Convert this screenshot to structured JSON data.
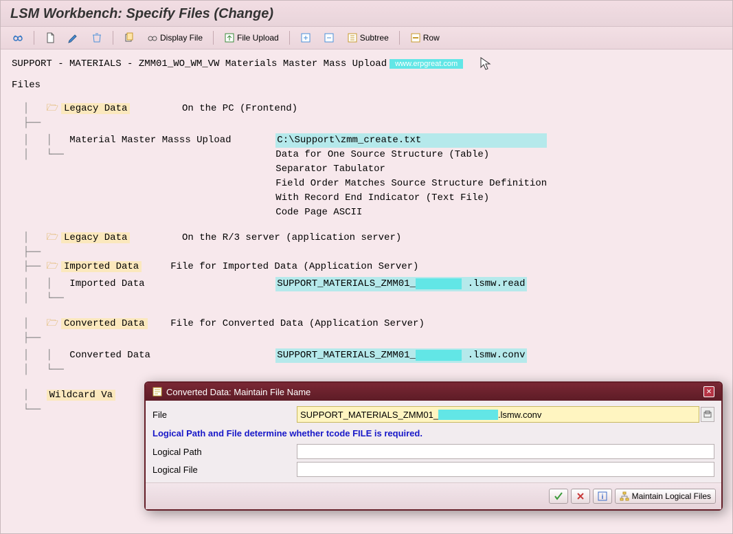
{
  "title": "LSM Workbench: Specify Files (Change)",
  "toolbar": {
    "display_file": "Display File",
    "file_upload": "File Upload",
    "subtree": "Subtree",
    "row": "Row"
  },
  "breadcrumb": "SUPPORT - MATERIALS - ZMM01_WO_WM_VW Materials Master Mass Upload",
  "watermark": "www.erpgreat.com",
  "tree": {
    "root": "Files",
    "legacy_pc": {
      "label": "Legacy Data",
      "desc": "On the PC (Frontend)",
      "child_label": "Material Master Masss Upload",
      "path": "C:\\Support\\zmm_create.txt",
      "lines": [
        "Data for One Source Structure (Table)",
        "Separator Tabulator",
        "Field Order Matches Source Structure Definition",
        "With Record End Indicator (Text File)",
        "Code Page ASCII"
      ]
    },
    "legacy_r3": {
      "label": "Legacy Data",
      "desc": "On the R/3 server (application server)"
    },
    "imported": {
      "label": "Imported Data",
      "desc": "File for Imported Data (Application Server)",
      "child_label": "Imported Data",
      "file_prefix": "SUPPORT_MATERIALS_ZMM01_",
      "file_suffix": ".lsmw.read"
    },
    "converted": {
      "label": "Converted Data",
      "desc": "File for Converted Data (Application Server)",
      "child_label": "Converted Data",
      "file_prefix": "SUPPORT_MATERIALS_ZMM01_",
      "file_suffix": ".lsmw.conv"
    },
    "wildcard": {
      "label": "Wildcard Va"
    }
  },
  "dialog": {
    "title": "Converted Data: Maintain File Name",
    "file_label": "File",
    "file_prefix": "SUPPORT_MATERIALS_ZMM01_",
    "file_suffix": ".lsmw.conv",
    "hint": "Logical Path and File determine whether tcode FILE is required.",
    "logical_path_label": "Logical Path",
    "logical_path_value": "",
    "logical_file_label": "Logical File",
    "logical_file_value": "",
    "maintain_btn": "Maintain Logical Files"
  }
}
